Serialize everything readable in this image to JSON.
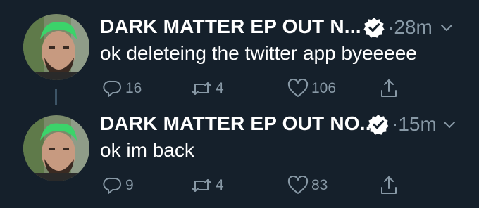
{
  "colors": {
    "background": "#15202b",
    "text_primary": "#ffffff",
    "text_secondary": "#8899a6",
    "thread_line": "#3d5466"
  },
  "tweets": [
    {
      "display_name": "DARK MATTER EP OUT N...",
      "verified_icon": "verified-badge-icon",
      "separator_time": "·28m",
      "text": "ok deleteing the twitter app byeeeee",
      "replies": "16",
      "retweets": "4",
      "likes": "106"
    },
    {
      "display_name": "DARK MATTER EP OUT NO...",
      "verified_icon": "verified-badge-icon",
      "separator_time": "·15m",
      "text": "ok im back",
      "replies": "9",
      "retweets": "4",
      "likes": "83"
    }
  ],
  "icons": {
    "reply": "reply-icon",
    "retweet": "retweet-icon",
    "like": "heart-icon",
    "share": "share-icon",
    "more": "chevron-down-icon"
  }
}
